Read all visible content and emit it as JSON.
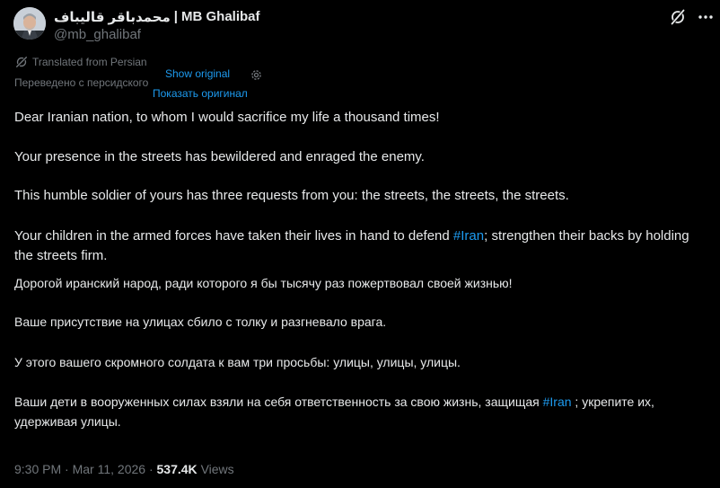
{
  "author": {
    "display_name_fa": "محمدباقر قالیباف",
    "separator": "|",
    "display_name_en": "MB Ghalibaf",
    "handle": "@mb_ghalibaf"
  },
  "translation": {
    "notice_en": "Translated from Persian",
    "show_original_en": "Show original",
    "notice_ru": "Переведено с персидского",
    "show_original_ru": "Показать оригинал"
  },
  "post_en": {
    "p1": "Dear Iranian nation, to whom I would sacrifice my life a thousand times!",
    "p2": "Your presence in the streets has bewildered and enraged the enemy.",
    "p3": "This humble soldier of yours has three requests from you: the streets, the streets, the streets.",
    "p4_before": "Your children in the armed forces have taken their lives in hand to defend ",
    "p4_tag": "#Iran",
    "p4_after": "; strengthen their backs by holding the streets firm."
  },
  "post_ru": {
    "p1": "Дорогой иранский народ, ради которого я бы тысячу раз пожертвовал своей жизнью!",
    "p2": "Ваше присутствие на улицах сбило с толку и разгневало врага.",
    "p3": "У этого вашего скромного солдата к вам три просьбы: улицы, улицы, улицы.",
    "p4_before": "Ваши дети в вооруженных силах взяли на себя ответственность за свою жизнь, защищая ",
    "p4_tag": "#Iran",
    "p4_after": " ; укрепите их, удерживая улицы."
  },
  "meta": {
    "time": "9:30 PM",
    "dot1": "·",
    "date": "Mar 11, 2026",
    "dot2": "·",
    "views_count": "537.4K",
    "views_label": "Views"
  },
  "colors": {
    "background": "#000000",
    "text": "#e7e9ea",
    "muted": "#71767b",
    "link": "#1d9bf0"
  },
  "icons": [
    "avatar",
    "grok-icon",
    "more-icon",
    "translate-icon",
    "gear-icon"
  ]
}
